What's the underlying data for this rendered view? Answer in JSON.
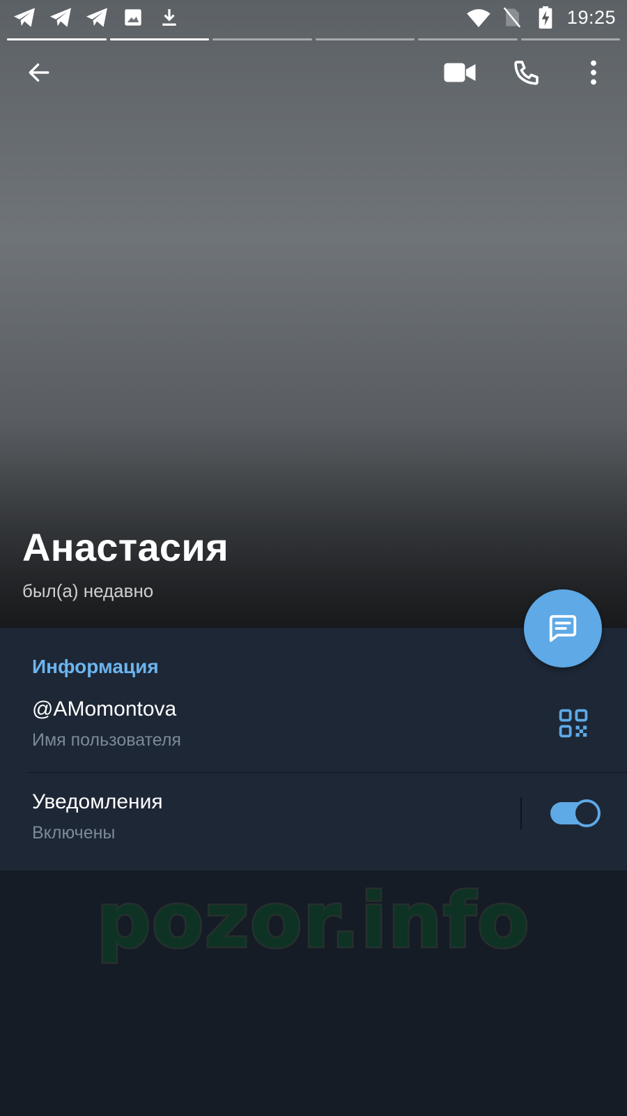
{
  "status_bar": {
    "time": "19:25",
    "notification_icons": [
      "telegram-icon",
      "telegram-icon",
      "telegram-icon",
      "image-icon",
      "download-icon"
    ],
    "system_icons": [
      "wifi-icon",
      "no-sim-icon",
      "battery-charging-icon"
    ]
  },
  "story_progress": {
    "segments": [
      1,
      1,
      0,
      0,
      0,
      0
    ],
    "current_index": 1
  },
  "header": {
    "back_icon": "arrow-back-icon",
    "video_call_icon": "video-call-icon",
    "call_icon": "phone-icon",
    "more_icon": "more-vert-icon"
  },
  "profile": {
    "name": "Анастасия",
    "last_seen": "был(а) недавно"
  },
  "fab": {
    "icon": "message-icon"
  },
  "info": {
    "section_title": "Информация",
    "username": "@AMomontova",
    "username_label": "Имя пользователя",
    "qr_icon": "qr-code-icon",
    "notifications_title": "Уведомления",
    "notifications_status": "Включены",
    "notifications_enabled": true
  },
  "watermark": "pozor.info",
  "colors": {
    "accent": "#5ea9e6",
    "section_title": "#6cb4ee",
    "panel": "#1d2735",
    "background": "#151c26"
  }
}
